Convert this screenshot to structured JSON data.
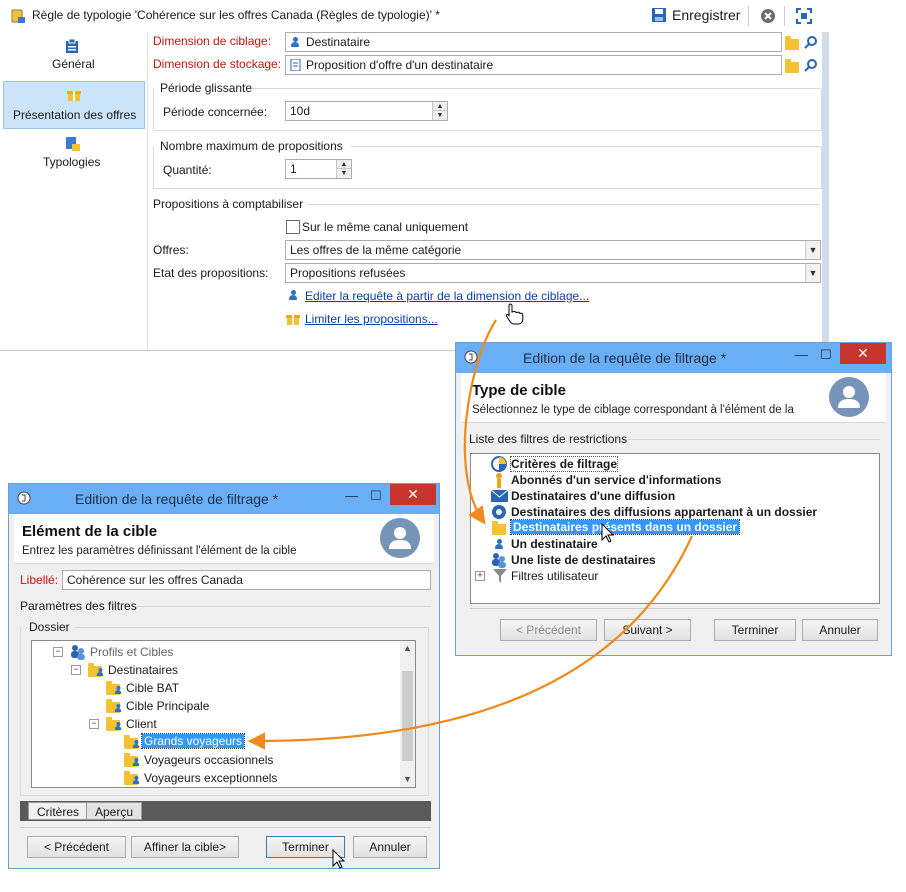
{
  "main_window": {
    "title": "Règle de typologie 'Cohérence sur les offres Canada (Règles de typologie)' *",
    "save_label": "Enregistrer",
    "nav": [
      {
        "label": "Général",
        "icon": "general-icon"
      },
      {
        "label": "Présentation des offres",
        "icon": "gift-icon"
      },
      {
        "label": "Typologies",
        "icon": "typology-icon"
      }
    ],
    "targeting_dimension_label": "Dimension de ciblage:",
    "targeting_dimension_value": "Destinataire",
    "storage_dimension_label": "Dimension de stockage:",
    "storage_dimension_value": "Proposition d'offre d'un destinataire",
    "sliding_period_group": "Période glissante",
    "period_label": "Période concernée:",
    "period_value": "10d",
    "max_propositions_group": "Nombre maximum de propositions",
    "quantity_label": "Quantité:",
    "quantity_value": "1",
    "propositions_group": "Propositions à comptabiliser",
    "same_channel_label": "Sur le même canal uniquement",
    "same_channel_checked": false,
    "offers_label": "Offres:",
    "offers_value": "Les offres de la même catégorie",
    "status_label": "Etat des propositions:",
    "status_value": "Propositions refusées",
    "edit_query_link": "Editer la requête à partir de la dimension de ciblage...",
    "limit_link": "Limiter les propositions..."
  },
  "dialog_target_type": {
    "title": "Edition de la requête de filtrage *",
    "header_title": "Type de cible",
    "header_subtitle": "Sélectionnez le type de ciblage correspondant à l'élément de la",
    "group_label": "Liste des filtres de restrictions",
    "items": [
      {
        "label": "Critères de filtrage",
        "icon": "filter-criteria-icon"
      },
      {
        "label": "Abonnés d'un service d'informations",
        "icon": "subscriber-icon"
      },
      {
        "label": "Destinataires d'une diffusion",
        "icon": "envelope-icon"
      },
      {
        "label": "Destinataires des diffusions appartenant à un dossier",
        "icon": "delivery-folder-icon"
      },
      {
        "label": "Destinataires présents dans un dossier",
        "icon": "recipient-folder-icon"
      },
      {
        "label": "Un destinataire",
        "icon": "person-icon"
      },
      {
        "label": "Une liste de destinataires",
        "icon": "people-list-icon"
      },
      {
        "label": "Filtres utilisateur",
        "icon": "funnel-icon"
      }
    ],
    "btn_prev": "< Précédent",
    "btn_next": "Suivant >",
    "btn_finish": "Terminer",
    "btn_cancel": "Annuler"
  },
  "dialog_target_element": {
    "title": "Edition de la requête de filtrage *",
    "header_title": "Elément de la cible",
    "header_subtitle": "Entrez les paramètres définissant l'élément de la cible",
    "label_label": "Libellé:",
    "label_value": "Cohérence sur les offres Canada",
    "filter_params_group": "Paramètres des filtres",
    "folder_group": "Dossier",
    "tree": [
      {
        "label": "Profils et Cibles",
        "expander": "−"
      },
      {
        "label": "Destinataires",
        "expander": "−"
      },
      {
        "label": "Cible BAT",
        "expander": ""
      },
      {
        "label": "Cible Principale",
        "expander": ""
      },
      {
        "label": "Client",
        "expander": "−"
      },
      {
        "label": "Grands voyageurs",
        "expander": ""
      },
      {
        "label": "Voyageurs occasionnels",
        "expander": ""
      },
      {
        "label": "Voyageurs exceptionnels",
        "expander": ""
      }
    ],
    "tabs": [
      "Critères",
      "Aperçu"
    ],
    "btn_prev": "< Précédent",
    "btn_refine": "Affiner la cible>",
    "btn_finish": "Terminer",
    "btn_cancel": "Annuler"
  },
  "colors": {
    "title_bar_blue": "#6aaef5",
    "selection_blue": "#3399ff",
    "required_label_red": "#c0160e",
    "link_blue": "#0a3fa8",
    "annotation_arrow_orange": "#f08a1c",
    "close_red": "#c7362e"
  }
}
